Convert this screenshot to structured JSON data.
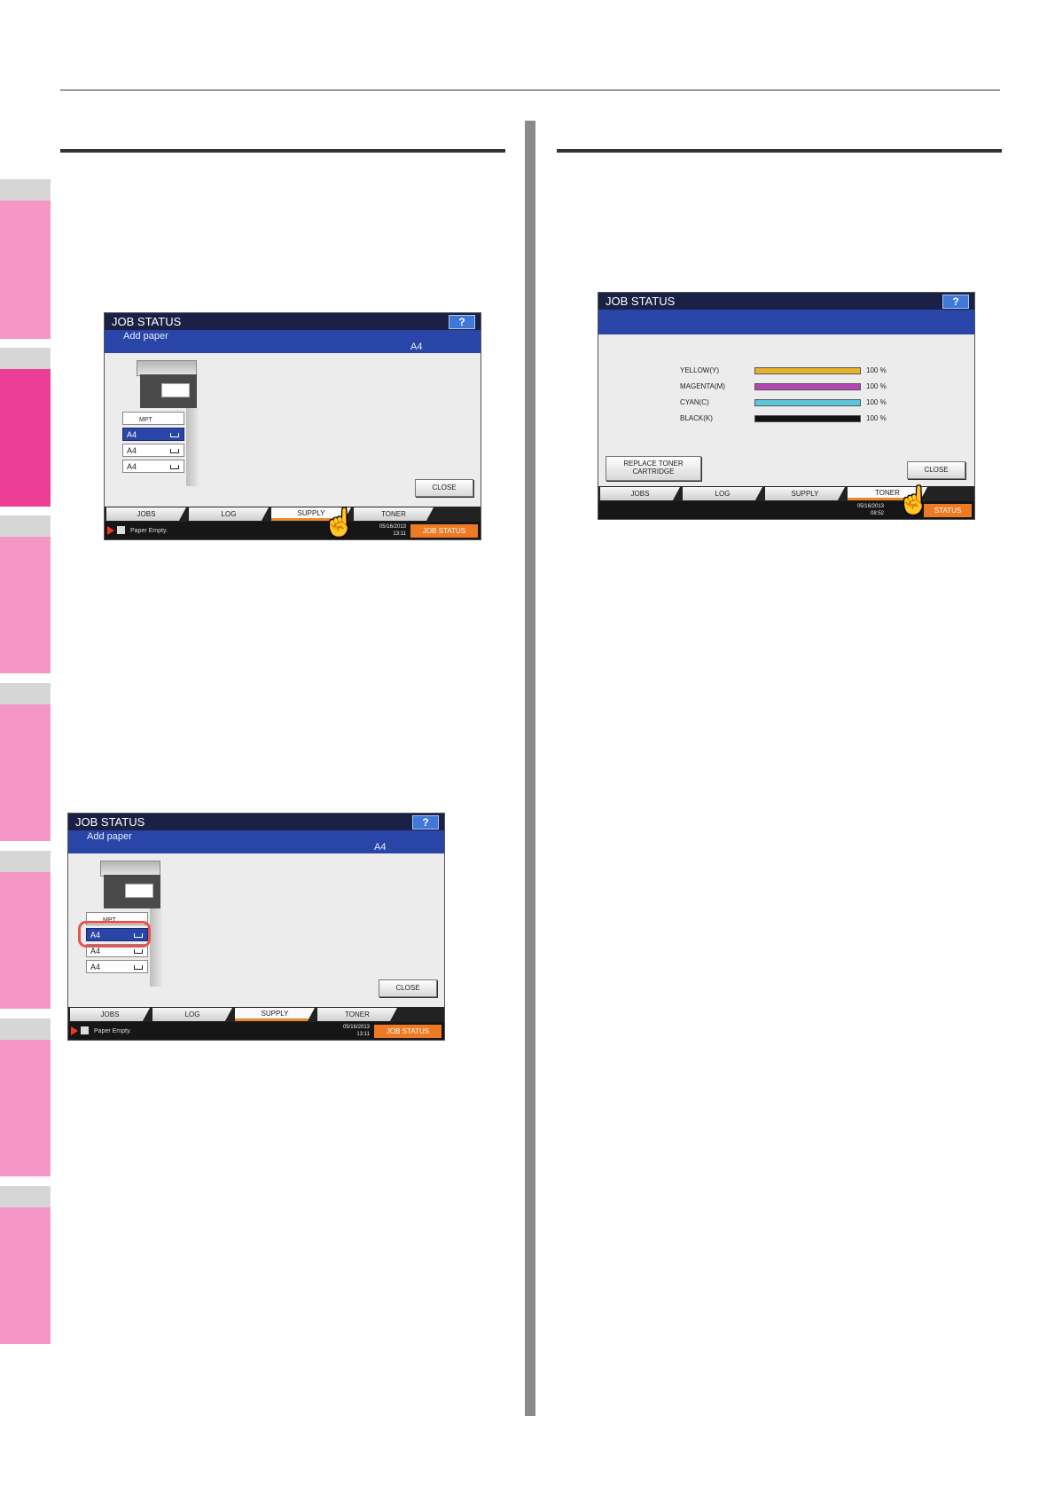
{
  "colors": {
    "accent_pink": "#f596c6",
    "accent_pink_active": "#ec3d97",
    "job_status_orange": "#ee7a24",
    "selected_blue": "#2a45a8",
    "highlight_red": "#e8544c"
  },
  "screens": [
    {
      "title": "JOB STATUS",
      "help": "?",
      "message": "Add paper",
      "paper_size": "A4",
      "trays": [
        {
          "label": "MPT",
          "icon": "manual-feed-icon",
          "selected": false
        },
        {
          "label": "A4",
          "selected": true
        },
        {
          "label": "A4",
          "selected": false
        },
        {
          "label": "A4",
          "selected": false
        }
      ],
      "close": "CLOSE",
      "tabs": [
        "JOBS",
        "LOG",
        "SUPPLY",
        "TONER"
      ],
      "active_tab": "SUPPLY",
      "status_text": "Paper Empty.",
      "date": "05/16/2013",
      "time": "13:11",
      "job_status_button": "JOB STATUS"
    },
    {
      "title": "JOB STATUS",
      "help": "?",
      "message": "Add paper",
      "paper_size": "A4",
      "trays": [
        {
          "label": "MPT",
          "icon": "manual-feed-icon",
          "selected": false
        },
        {
          "label": "A4",
          "selected": true
        },
        {
          "label": "A4",
          "selected": false
        },
        {
          "label": "A4",
          "selected": false
        }
      ],
      "close": "CLOSE",
      "tabs": [
        "JOBS",
        "LOG",
        "SUPPLY",
        "TONER"
      ],
      "active_tab": "SUPPLY",
      "status_text": "Paper Empty.",
      "date": "05/16/2013",
      "time": "13:11",
      "job_status_button": "JOB STATUS"
    },
    {
      "title": "JOB STATUS",
      "help": "?",
      "toner": [
        {
          "label": "YELLOW(Y)",
          "percent": "100 %",
          "color": "#e8b22c"
        },
        {
          "label": "MAGENTA(M)",
          "percent": "100 %",
          "color": "#b447b3"
        },
        {
          "label": "CYAN(C)",
          "percent": "100 %",
          "color": "#5cc6db"
        },
        {
          "label": "BLACK(K)",
          "percent": "100 %",
          "color": "#111111"
        }
      ],
      "replace_button_line1": "REPLACE TONER",
      "replace_button_line2": "CARTRIDGE",
      "close": "CLOSE",
      "tabs": [
        "JOBS",
        "LOG",
        "SUPPLY",
        "TONER"
      ],
      "active_tab": "TONER",
      "date": "05/16/2013",
      "time": "08:52",
      "job_status_button": "STATUS"
    }
  ]
}
